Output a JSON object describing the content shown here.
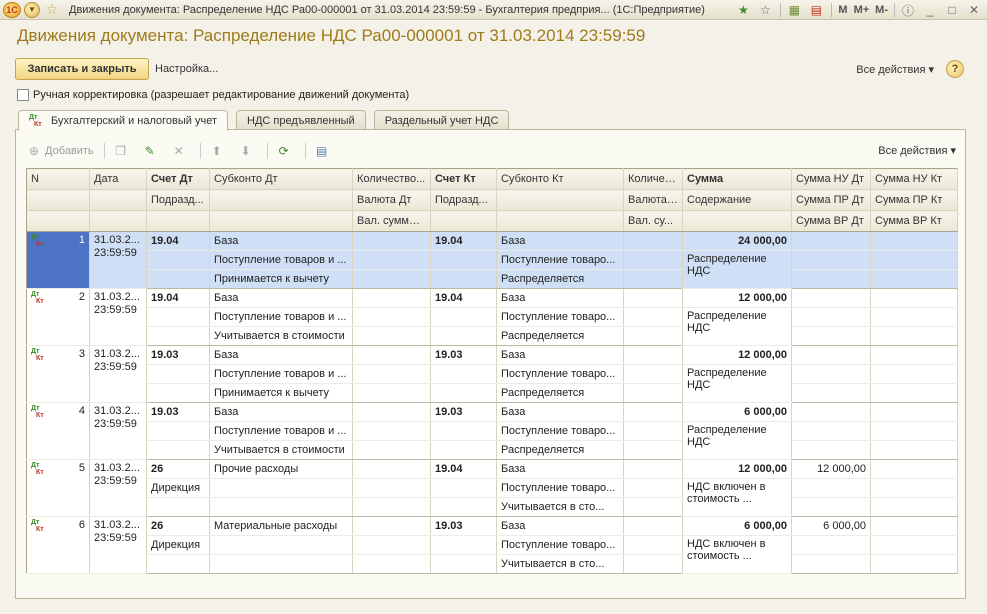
{
  "window": {
    "title": "Движения документа: Распределение НДС Ра00-000001 от 31.03.2014 23:59:59 - Бухгалтерия предприя...  (1С:Предприятие)",
    "logo": "1С",
    "m_buttons": [
      "M",
      "M+",
      "M-"
    ]
  },
  "doc": {
    "title": "Движения документа: Распределение НДС Ра00-000001 от 31.03.2014 23:59:59",
    "save_close": "Записать и закрыть",
    "setup": "Настройка...",
    "all_actions": "Все действия ▾",
    "help": "?",
    "manual_label": "Ручная корректировка (разрешает редактирование движений документа)"
  },
  "tabs": [
    {
      "label": "Бухгалтерский и налоговый учет",
      "active": true
    },
    {
      "label": "НДС предъявленный",
      "active": false
    },
    {
      "label": "Раздельный учет НДС",
      "active": false
    }
  ],
  "toolbar": {
    "add": "Добавить",
    "all_actions": "Все действия ▾",
    "icons": [
      "add-icon",
      "copy-icon",
      "edit-icon",
      "delete-icon",
      "move-up-icon",
      "move-down-icon",
      "refresh-icon",
      "report-icon"
    ]
  },
  "columns": {
    "row1": [
      "N",
      "Дата",
      "Счет Дт",
      "Субконто Дт",
      "Количество...",
      "Счет Кт",
      "Субконто Кт",
      "Количес...",
      "Сумма",
      "Сумма НУ Дт",
      "Сумма НУ Кт"
    ],
    "row2": [
      "",
      "",
      "Подразд...",
      "",
      "Валюта Дт",
      "Подразд...",
      "",
      "Валюта ...",
      "Содержание",
      "Сумма ПР Дт",
      "Сумма ПР Кт"
    ],
    "row3": [
      "",
      "",
      "",
      "",
      "Вал. сумма ...",
      "",
      "",
      "Вал. су...",
      "",
      "Сумма ВР Дт",
      "Сумма ВР Кт"
    ]
  },
  "records": [
    {
      "n": "1",
      "date": "31.03.2...",
      "time": "23:59:59",
      "acc_dt": "19.04",
      "div_dt": "",
      "sub_dt": [
        "База",
        "Поступление товаров и ...",
        "Принимается к вычету"
      ],
      "acc_kt": "19.04",
      "sub_kt": [
        "База",
        "Поступление товаро...",
        "Распределяется"
      ],
      "sum": "24 000,00",
      "content": "Распределение НДС",
      "nu_dt": "",
      "nu_kt": "",
      "selected": true
    },
    {
      "n": "2",
      "date": "31.03.2...",
      "time": "23:59:59",
      "acc_dt": "19.04",
      "div_dt": "",
      "sub_dt": [
        "База",
        "Поступление товаров и ...",
        "Учитывается в стоимости"
      ],
      "acc_kt": "19.04",
      "sub_kt": [
        "База",
        "Поступление товаро...",
        "Распределяется"
      ],
      "sum": "12 000,00",
      "content": "Распределение НДС",
      "nu_dt": "",
      "nu_kt": "",
      "selected": false
    },
    {
      "n": "3",
      "date": "31.03.2...",
      "time": "23:59:59",
      "acc_dt": "19.03",
      "div_dt": "",
      "sub_dt": [
        "База",
        "Поступление товаров и ...",
        "Принимается к вычету"
      ],
      "acc_kt": "19.03",
      "sub_kt": [
        "База",
        "Поступление товаро...",
        "Распределяется"
      ],
      "sum": "12 000,00",
      "content": "Распределение НДС",
      "nu_dt": "",
      "nu_kt": "",
      "selected": false
    },
    {
      "n": "4",
      "date": "31.03.2...",
      "time": "23:59:59",
      "acc_dt": "19.03",
      "div_dt": "",
      "sub_dt": [
        "База",
        "Поступление товаров и ...",
        "Учитывается в стоимости"
      ],
      "acc_kt": "19.03",
      "sub_kt": [
        "База",
        "Поступление товаро...",
        "Распределяется"
      ],
      "sum": "6 000,00",
      "content": "Распределение НДС",
      "nu_dt": "",
      "nu_kt": "",
      "selected": false
    },
    {
      "n": "5",
      "date": "31.03.2...",
      "time": "23:59:59",
      "acc_dt": "26",
      "div_dt": "Дирекция",
      "sub_dt": [
        "Прочие расходы",
        "",
        ""
      ],
      "acc_kt": "19.04",
      "sub_kt": [
        "База",
        "Поступление товаро...",
        "Учитывается в сто..."
      ],
      "sum": "12 000,00",
      "content": "НДС включен в стоимость ...",
      "nu_dt": "12 000,00",
      "nu_kt": "",
      "selected": false
    },
    {
      "n": "6",
      "date": "31.03.2...",
      "time": "23:59:59",
      "acc_dt": "26",
      "div_dt": "Дирекция",
      "sub_dt": [
        "Материальные расходы",
        "",
        ""
      ],
      "acc_kt": "19.03",
      "sub_kt": [
        "База",
        "Поступление товаро...",
        "Учитывается в сто..."
      ],
      "sum": "6 000,00",
      "content": "НДС включен в стоимость ...",
      "nu_dt": "6 000,00",
      "nu_kt": "",
      "selected": false
    }
  ]
}
